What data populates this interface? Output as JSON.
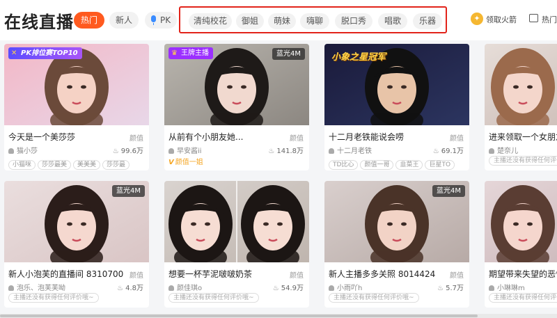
{
  "page": {
    "title": "在线直播"
  },
  "filters": {
    "hot": "热门",
    "new": "新人",
    "pk": "PK",
    "categories": [
      "清纯校花",
      "御姐",
      "萌妹",
      "嗨聊",
      "脱口秀",
      "唱歌",
      "乐器"
    ]
  },
  "header_right": {
    "rocket_label": "领取火箭",
    "recommend_label": "热门"
  },
  "cards": [
    {
      "title": "今天是一个美莎莎",
      "category": "颜值",
      "user": "猫小莎",
      "hot": "99.6万",
      "tags": [
        "小猫咪",
        "莎莎最美",
        "美美美",
        "莎莎最"
      ],
      "badge_rank": "PK排位赛TOP10",
      "colors": {
        "bg1": "#f3b7c6",
        "bg2": "#e8d7e8",
        "hair": "#6b4a3a",
        "skin": "#f5d2c5"
      }
    },
    {
      "title": "从前有个小朋友她...",
      "category": "颜值",
      "user": "早安酱ii",
      "hot": "141.8万",
      "honor": "颜值一姐",
      "badge_star": "王牌主播",
      "badge_quality": "蓝光4M",
      "colors": {
        "bg1": "#b9b5ae",
        "bg2": "#8c8781",
        "hair": "#1e1a18",
        "skin": "#f1d9cf"
      }
    },
    {
      "title": "十二月老铁能说会唠",
      "category": "颜值",
      "user": "十二月老铁",
      "hot": "69.1万",
      "tags": [
        "TD比心",
        "颜值一哥",
        "韭菜王",
        "巨星TO"
      ],
      "colors": {
        "bg1": "#1a1a3a",
        "bg2": "#2c3560",
        "hair": "#111111",
        "skin": "#e8c4a8"
      },
      "overlay_text": "小象之星冠军"
    },
    {
      "title": "进来领取一个女朋友",
      "category": "颜值",
      "user": "楚奈儿",
      "hot": "",
      "pill": "主播还没有获得任何评价哦~",
      "colors": {
        "bg1": "#e6ddd8",
        "bg2": "#c9b8b2",
        "hair": "#9b6a4c",
        "skin": "#f4d6cb"
      }
    },
    {
      "title": "新人小泡芙的直播间 8310700",
      "category": "颜值",
      "user": "泡乐、泡芙芙呦",
      "hot": "4.8万",
      "pill": "主播还没有获得任何评价哦~",
      "badge_quality": "蓝光4M",
      "colors": {
        "bg1": "#eadede",
        "bg2": "#d9c5c5",
        "hair": "#2b1d1a",
        "skin": "#f5d8cf"
      }
    },
    {
      "title": "想要一杯芋泥啵啵奶茶",
      "category": "颜值",
      "user": "颜佳琪o",
      "hot": "54.9万",
      "pill": "主播还没有获得任何评价哦~",
      "colors": {
        "bg1": "#d9d3cf",
        "bg2": "#bfb5ae",
        "hair": "#1c1614",
        "skin": "#f6ddd3"
      }
    },
    {
      "title": "新人主播多多关照 8014424",
      "category": "颜值",
      "user": "小雨吖h",
      "hot": "5.7万",
      "pill": "主播还没有获得任何评价哦~",
      "badge_quality": "蓝光4M",
      "colors": {
        "bg1": "#d9cfcd",
        "bg2": "#b7aaa6",
        "hair": "#4a3328",
        "skin": "#f2d3c6"
      }
    },
    {
      "title": "期望带来失望的恶性",
      "category": "颜值",
      "user": "小琳琳m",
      "hot": "",
      "pill": "主播还没有获得任何评价哦~",
      "colors": {
        "bg1": "#e5d6d8",
        "bg2": "#c8b3b6",
        "hair": "#5a3d33",
        "skin": "#f5d6cd"
      }
    }
  ]
}
